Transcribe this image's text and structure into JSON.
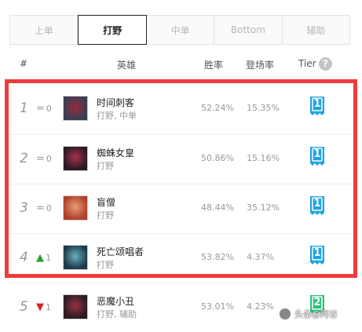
{
  "tabs": [
    {
      "label": "上单",
      "active": false
    },
    {
      "label": "打野",
      "active": true
    },
    {
      "label": "中单",
      "active": false
    },
    {
      "label": "Bottom",
      "active": false
    },
    {
      "label": "辅助",
      "active": false
    }
  ],
  "header": {
    "rank": "#",
    "hero": "英雄",
    "winrate": "胜率",
    "pickrate": "登场率",
    "tier": "Tier",
    "help": "?"
  },
  "rows": [
    {
      "rank": "1",
      "change_symbol": "=",
      "change_value": "0",
      "change_dir": "same",
      "name": "时间刺客",
      "roles": "打野, 中单",
      "winrate": "52.24%",
      "pickrate": "15.35%",
      "tier": "1",
      "tier_color": "#1fa5e0",
      "avatar_colors": [
        "#3a3f52",
        "#9a2a3a"
      ]
    },
    {
      "rank": "2",
      "change_symbol": "=",
      "change_value": "0",
      "change_dir": "same",
      "name": "蜘蛛女皇",
      "roles": "打野",
      "winrate": "50.86%",
      "pickrate": "15.16%",
      "tier": "1",
      "tier_color": "#1fa5e0",
      "avatar_colors": [
        "#2a1a24",
        "#a8324a"
      ]
    },
    {
      "rank": "3",
      "change_symbol": "=",
      "change_value": "0",
      "change_dir": "same",
      "name": "盲僧",
      "roles": "打野",
      "winrate": "48.44%",
      "pickrate": "35.12%",
      "tier": "1",
      "tier_color": "#1fa5e0",
      "avatar_colors": [
        "#b0402e",
        "#e8a070"
      ]
    },
    {
      "rank": "4",
      "change_symbol": "▲",
      "change_value": "1",
      "change_dir": "up",
      "name": "死亡颂唱者",
      "roles": "打野",
      "winrate": "53.82%",
      "pickrate": "4.37%",
      "tier": "1",
      "tier_color": "#1fa5e0",
      "avatar_colors": [
        "#1e3a4a",
        "#6ab0c0"
      ]
    },
    {
      "rank": "5",
      "change_symbol": "▼",
      "change_value": "1",
      "change_dir": "down",
      "name": "恶魔小丑",
      "roles": "打野, 辅助",
      "winrate": "53.01%",
      "pickrate": "4.23%",
      "tier": "2",
      "tier_color": "#2ec27e",
      "avatar_colors": [
        "#2a1c22",
        "#9a3044"
      ]
    }
  ],
  "watermark": {
    "text": "头条@阿谷"
  }
}
